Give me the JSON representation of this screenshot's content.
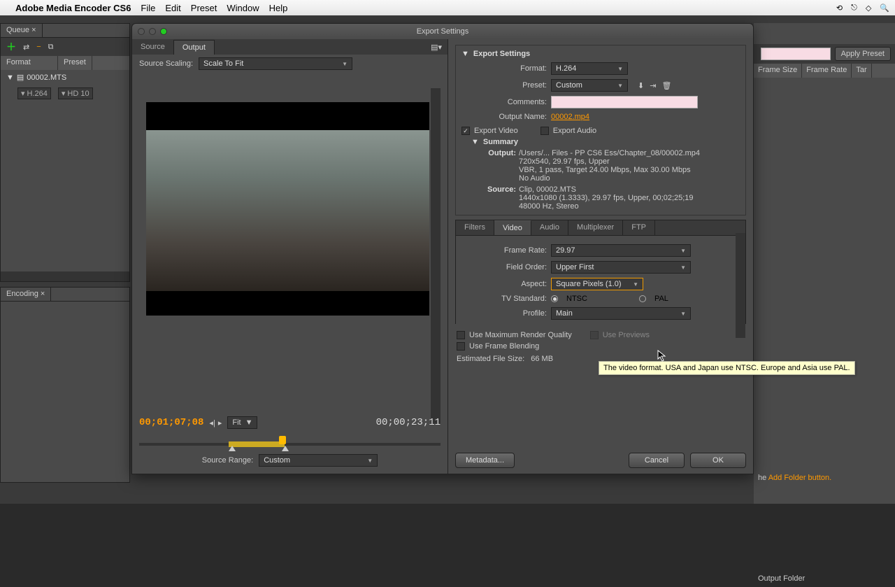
{
  "menubar": {
    "app": "Adobe Media Encoder CS6",
    "items": [
      "File",
      "Edit",
      "Preset",
      "Window",
      "Help"
    ]
  },
  "queue": {
    "tab": "Queue",
    "col_format": "Format",
    "col_preset": "Preset",
    "file": "00002.MTS",
    "format": "H.264",
    "preset": "HD 10"
  },
  "encoding": {
    "tab": "Encoding"
  },
  "right_side": {
    "apply_preset": "Apply Preset",
    "cols": [
      "Frame Size",
      "Frame Rate",
      "Tar"
    ],
    "output_folder": "Output Folder",
    "addfolder_pre": "he ",
    "addfolder_link": "Add Folder button."
  },
  "dialog": {
    "title": "Export Settings",
    "tabs": {
      "source": "Source",
      "output": "Output"
    },
    "source_scaling_label": "Source Scaling:",
    "source_scaling_value": "Scale To Fit",
    "timecode_in": "00;01;07;08",
    "timecode_out": "00;00;23;11",
    "fit": "Fit",
    "source_range_label": "Source Range:",
    "source_range_value": "Custom",
    "export_settings": {
      "title": "Export Settings",
      "format_label": "Format:",
      "format_value": "H.264",
      "preset_label": "Preset:",
      "preset_value": "Custom",
      "comments_label": "Comments:",
      "output_name_label": "Output Name:",
      "output_name_value": "00002.mp4",
      "export_video": "Export Video",
      "export_audio": "Export Audio",
      "summary_label": "Summary",
      "output_k": "Output:",
      "output_v1": "/Users/... Files - PP CS6 Ess/Chapter_08/00002.mp4",
      "output_v2": "720x540, 29.97 fps, Upper",
      "output_v3": "VBR, 1 pass, Target 24.00 Mbps, Max 30.00 Mbps",
      "output_v4": "No Audio",
      "source_k": "Source:",
      "source_v1": "Clip, 00002.MTS",
      "source_v2": "1440x1080 (1.3333), 29.97 fps, Upper, 00;02;25;19",
      "source_v3": "48000 Hz, Stereo"
    },
    "settings_tabs": [
      "Filters",
      "Video",
      "Audio",
      "Multiplexer",
      "FTP"
    ],
    "video": {
      "frame_rate_label": "Frame Rate:",
      "frame_rate_value": "29.97",
      "field_order_label": "Field Order:",
      "field_order_value": "Upper First",
      "aspect_label": "Aspect:",
      "aspect_value": "Square Pixels (1.0)",
      "tv_std_label": "TV Standard:",
      "ntsc": "NTSC",
      "pal": "PAL",
      "profile_label": "Profile:",
      "profile_value": "Main"
    },
    "bottom": {
      "max_quality": "Use Maximum Render Quality",
      "use_previews": "Use Previews",
      "frame_blending": "Use Frame Blending",
      "est_label": "Estimated File Size:",
      "est_value": "66 MB",
      "metadata": "Metadata...",
      "cancel": "Cancel",
      "ok": "OK"
    },
    "tooltip": "The video format. USA and Japan use NTSC. Europe and Asia use PAL."
  }
}
